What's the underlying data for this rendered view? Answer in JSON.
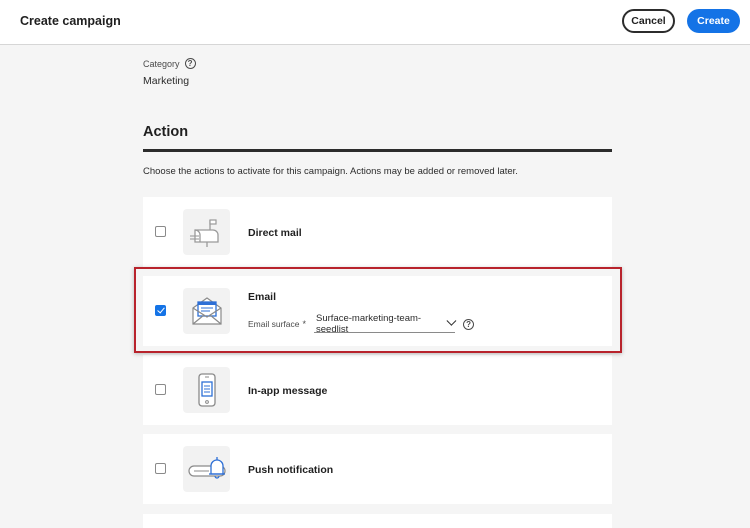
{
  "header": {
    "title": "Create campaign",
    "cancel_label": "Cancel",
    "create_label": "Create"
  },
  "category": {
    "label": "Category",
    "help": "?",
    "value": "Marketing"
  },
  "action": {
    "title": "Action",
    "description": "Choose the actions to activate for this campaign. Actions may be added or removed later.",
    "items": [
      {
        "label": "Direct mail",
        "checked": false,
        "icon": "mailbox-icon"
      },
      {
        "label": "Email",
        "checked": true,
        "icon": "envelope-icon",
        "surface_label": "Email surface",
        "surface_required": "*",
        "surface_value": "Surface-marketing-team-seedlist",
        "surface_help": "?"
      },
      {
        "label": "In-app message",
        "checked": false,
        "icon": "phone-message-icon"
      },
      {
        "label": "Push notification",
        "checked": false,
        "icon": "bell-notification-icon"
      }
    ]
  },
  "colors": {
    "accent": "#1473e6",
    "highlight": "#b8232c",
    "icon_blue": "#2d6fd6"
  }
}
